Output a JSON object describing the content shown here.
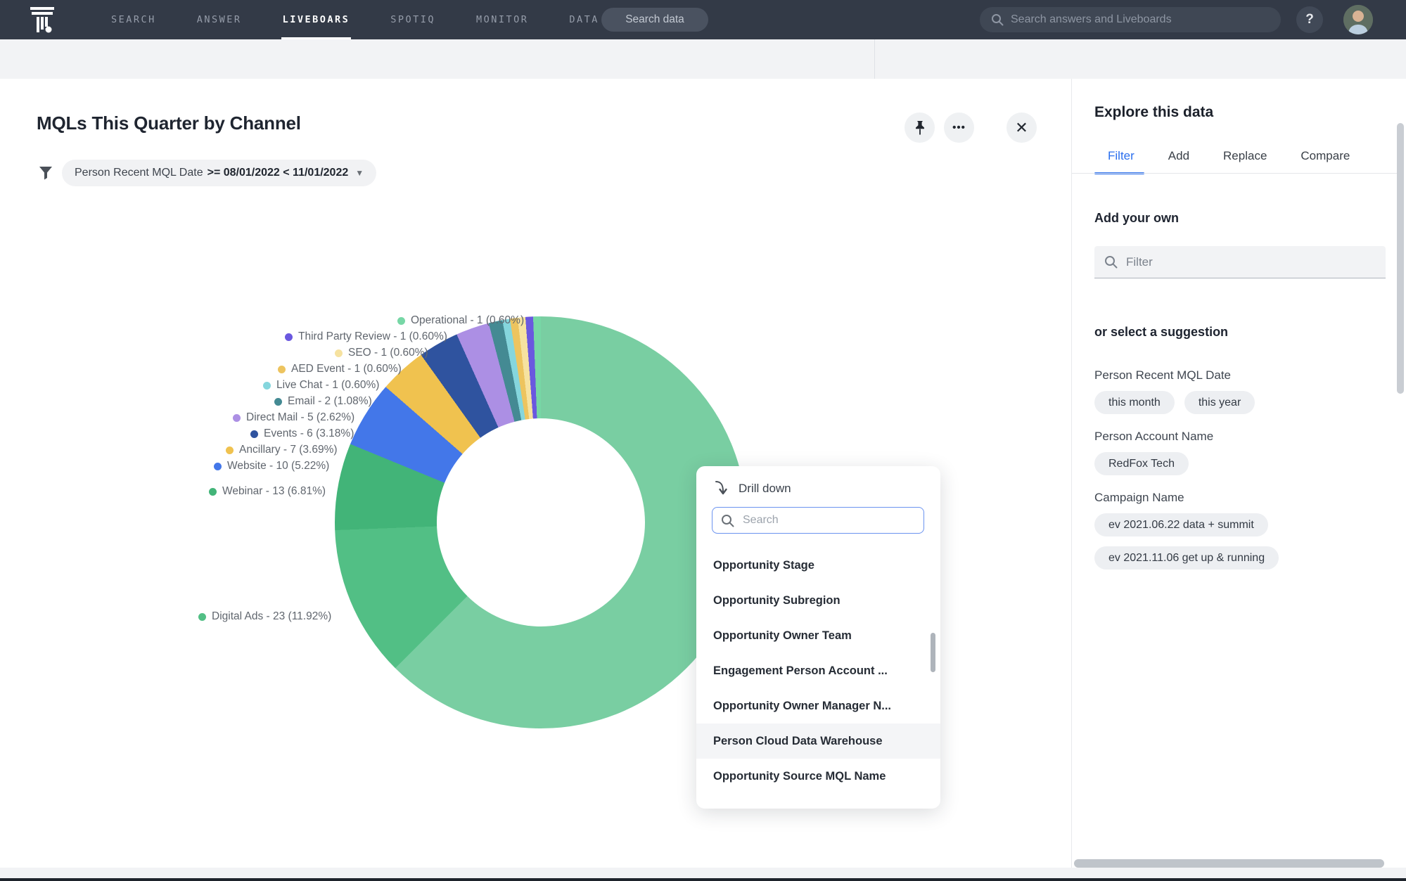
{
  "navbar": {
    "logo": "thoughtspot-mark",
    "items": [
      {
        "label": "SEARCH",
        "active": false
      },
      {
        "label": "ANSWER",
        "active": false
      },
      {
        "label": "LIVEBOARS",
        "active": true
      },
      {
        "label": "SPOTIQ",
        "active": false
      },
      {
        "label": "MONITOR",
        "active": false
      },
      {
        "label": "DATA",
        "active": false
      }
    ],
    "search_data_button": "Search data",
    "global_search_placeholder": "Search answers and Liveboards",
    "help_label": "?"
  },
  "viz": {
    "title": "MQLs This Quarter by Channel",
    "filter_chip": {
      "field": "Person Recent MQL Date",
      "condition": ">= 08/01/2022 < 11/01/2022"
    },
    "actions": {
      "more_label": "•••",
      "close_label": "✕"
    }
  },
  "chart_data": {
    "type": "pie",
    "donut": true,
    "title": "MQLs This Quarter by Channel",
    "legend_position": "left",
    "start_angle_deg": 0,
    "direction": "clockwise",
    "slices": [
      {
        "name": null,
        "value": null,
        "pct": 62.48,
        "color": "#79CEA2",
        "label": null,
        "note": "largest slice; label hidden behind drill-down menu"
      },
      {
        "name": "Digital Ads",
        "value": 23,
        "pct": 11.92,
        "color": "#52BF85",
        "label": "Digital Ads - 23 (11.92%)"
      },
      {
        "name": "Webinar",
        "value": 13,
        "pct": 6.81,
        "color": "#42B478",
        "label": "Webinar - 13 (6.81%)"
      },
      {
        "name": "Website",
        "value": 10,
        "pct": 5.22,
        "color": "#4377E9",
        "label": "Website - 10 (5.22%)"
      },
      {
        "name": "Ancillary",
        "value": 7,
        "pct": 3.69,
        "color": "#F0C24F",
        "label": "Ancillary - 7 (3.69%)"
      },
      {
        "name": "Events",
        "value": 6,
        "pct": 3.18,
        "color": "#2F539F",
        "label": "Events - 6 (3.18%)"
      },
      {
        "name": "Direct Mail",
        "value": 5,
        "pct": 2.62,
        "color": "#AC8FE4",
        "label": "Direct Mail - 5 (2.62%)"
      },
      {
        "name": "Email",
        "value": 2,
        "pct": 1.08,
        "color": "#448A93",
        "label": "Email - 2 (1.08%)"
      },
      {
        "name": "Live Chat",
        "value": 1,
        "pct": 0.6,
        "color": "#85D6DD",
        "label": "Live Chat - 1 (0.60%)"
      },
      {
        "name": "AED Event",
        "value": 1,
        "pct": 0.6,
        "color": "#EDC45F",
        "label": "AED Event - 1 (0.60%)"
      },
      {
        "name": "SEO",
        "value": 1,
        "pct": 0.6,
        "color": "#F6E2A0",
        "label": "SEO - 1 (0.60%)"
      },
      {
        "name": "Third Party Review",
        "value": 1,
        "pct": 0.6,
        "color": "#6A58DF",
        "label": "Third Party Review - 1 (0.60%)"
      },
      {
        "name": "Operational",
        "value": 1,
        "pct": 0.6,
        "color": "#77D7A6",
        "label": "Operational - 1 (0.60%)"
      }
    ]
  },
  "drilldown": {
    "title": "Drill down",
    "search_placeholder": "Search",
    "items": [
      "Opportunity Stage",
      "Opportunity Subregion",
      "Opportunity Owner Team",
      "Engagement Person Account ...",
      "Opportunity Owner Manager N...",
      "Person Cloud Data Warehouse",
      "Opportunity Source MQL Name"
    ],
    "highlighted_item": "Person Cloud Data Warehouse"
  },
  "explore_panel": {
    "title": "Explore this data",
    "tabs": [
      {
        "label": "Filter",
        "active": true
      },
      {
        "label": "Add",
        "active": false
      },
      {
        "label": "Replace",
        "active": false
      },
      {
        "label": "Compare",
        "active": false
      }
    ],
    "add_your_own_heading": "Add your own",
    "filter_placeholder": "Filter",
    "suggestion_heading": "or select a suggestion",
    "suggestions": [
      {
        "field": "Person Recent MQL Date",
        "chips": [
          "this month",
          "this year"
        ]
      },
      {
        "field": "Person Account Name",
        "chips": [
          "RedFox Tech"
        ]
      },
      {
        "field": "Campaign Name",
        "chips": [
          "ev 2021.06.22 data + summit",
          "ev 2021.11.06 get up & running"
        ]
      }
    ]
  },
  "colors": {
    "accent_blue": "#2B6FEE",
    "navbar_bg": "#333A47",
    "page_bg": "#F2F3F5"
  }
}
